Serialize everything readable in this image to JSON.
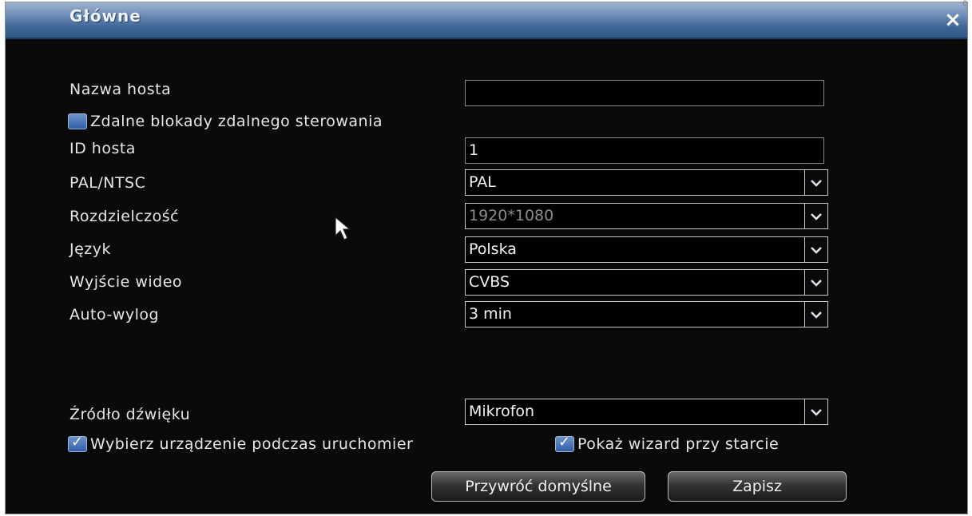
{
  "window": {
    "title": "Główne",
    "close_glyph": "×",
    "corner_mark": "0"
  },
  "fields": {
    "host_name": {
      "label": "Nazwa hosta",
      "value": ""
    },
    "remote_lock": {
      "label": "Zdalne blokady zdalnego sterowania",
      "checked": false
    },
    "host_id": {
      "label": "ID hosta",
      "value": "1"
    },
    "pal_ntsc": {
      "label": "PAL/NTSC",
      "value": "PAL"
    },
    "resolution": {
      "label": "Rozdzielczość",
      "value": "1920*1080",
      "disabled": true
    },
    "language": {
      "label": "Język",
      "value": "Polska"
    },
    "video_output": {
      "label": "Wyjście wideo",
      "value": "CVBS"
    },
    "auto_logout": {
      "label": "Auto-wylog",
      "value": "3 min"
    },
    "audio_source": {
      "label": "Źródło dźwięku",
      "value": "Mikrofon"
    }
  },
  "checkboxes": {
    "select_device_startup": {
      "label": "Wybierz urządzenie podczas uruchomier",
      "checked": true
    },
    "show_wizard": {
      "label": "Pokaż wizard przy starcie",
      "checked": true
    }
  },
  "buttons": {
    "restore_defaults": "Przywróć domyślne",
    "save": "Zapisz"
  },
  "icons": {
    "close": "close-icon",
    "dropdown": "chevron-down-icon",
    "cursor": "mouse-pointer-icon"
  },
  "colors": {
    "titlebar": "#3f6696",
    "background": "#0a0a0a",
    "checkbox": "#2f5fa8"
  }
}
